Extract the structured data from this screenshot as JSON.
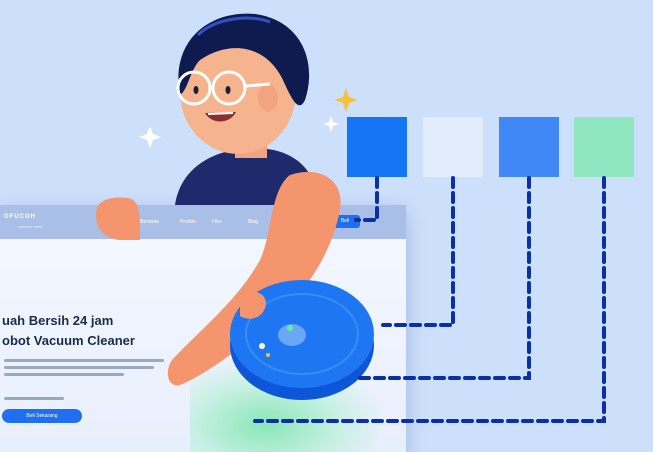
{
  "palette": {
    "swatches": [
      {
        "name": "primary-blue",
        "color": "#1475f5"
      },
      {
        "name": "light-blue",
        "color": "#e2ecfb"
      },
      {
        "name": "medium-blue",
        "color": "#3f88f5"
      },
      {
        "name": "mint-green",
        "color": "#8fe6bf"
      }
    ],
    "connector_color": "#0b2fa6"
  },
  "mockup": {
    "brand": "OFUCOH",
    "brand_sub": "vacuum robot",
    "nav_links": [
      "Beranda",
      "Produk",
      "Fitur",
      "Blog"
    ],
    "nav_cta": "Beli",
    "headline_line1": "uah Bersih 24 jam",
    "headline_line2": "obot Vacuum Cleaner",
    "cta_label": "Beli Sekarang"
  },
  "illustration": {
    "character": "woman-with-glasses",
    "device": "robot-vacuum-icon",
    "sparkles": [
      "sparkle-white",
      "sparkle-yellow",
      "sparkle-white"
    ]
  }
}
